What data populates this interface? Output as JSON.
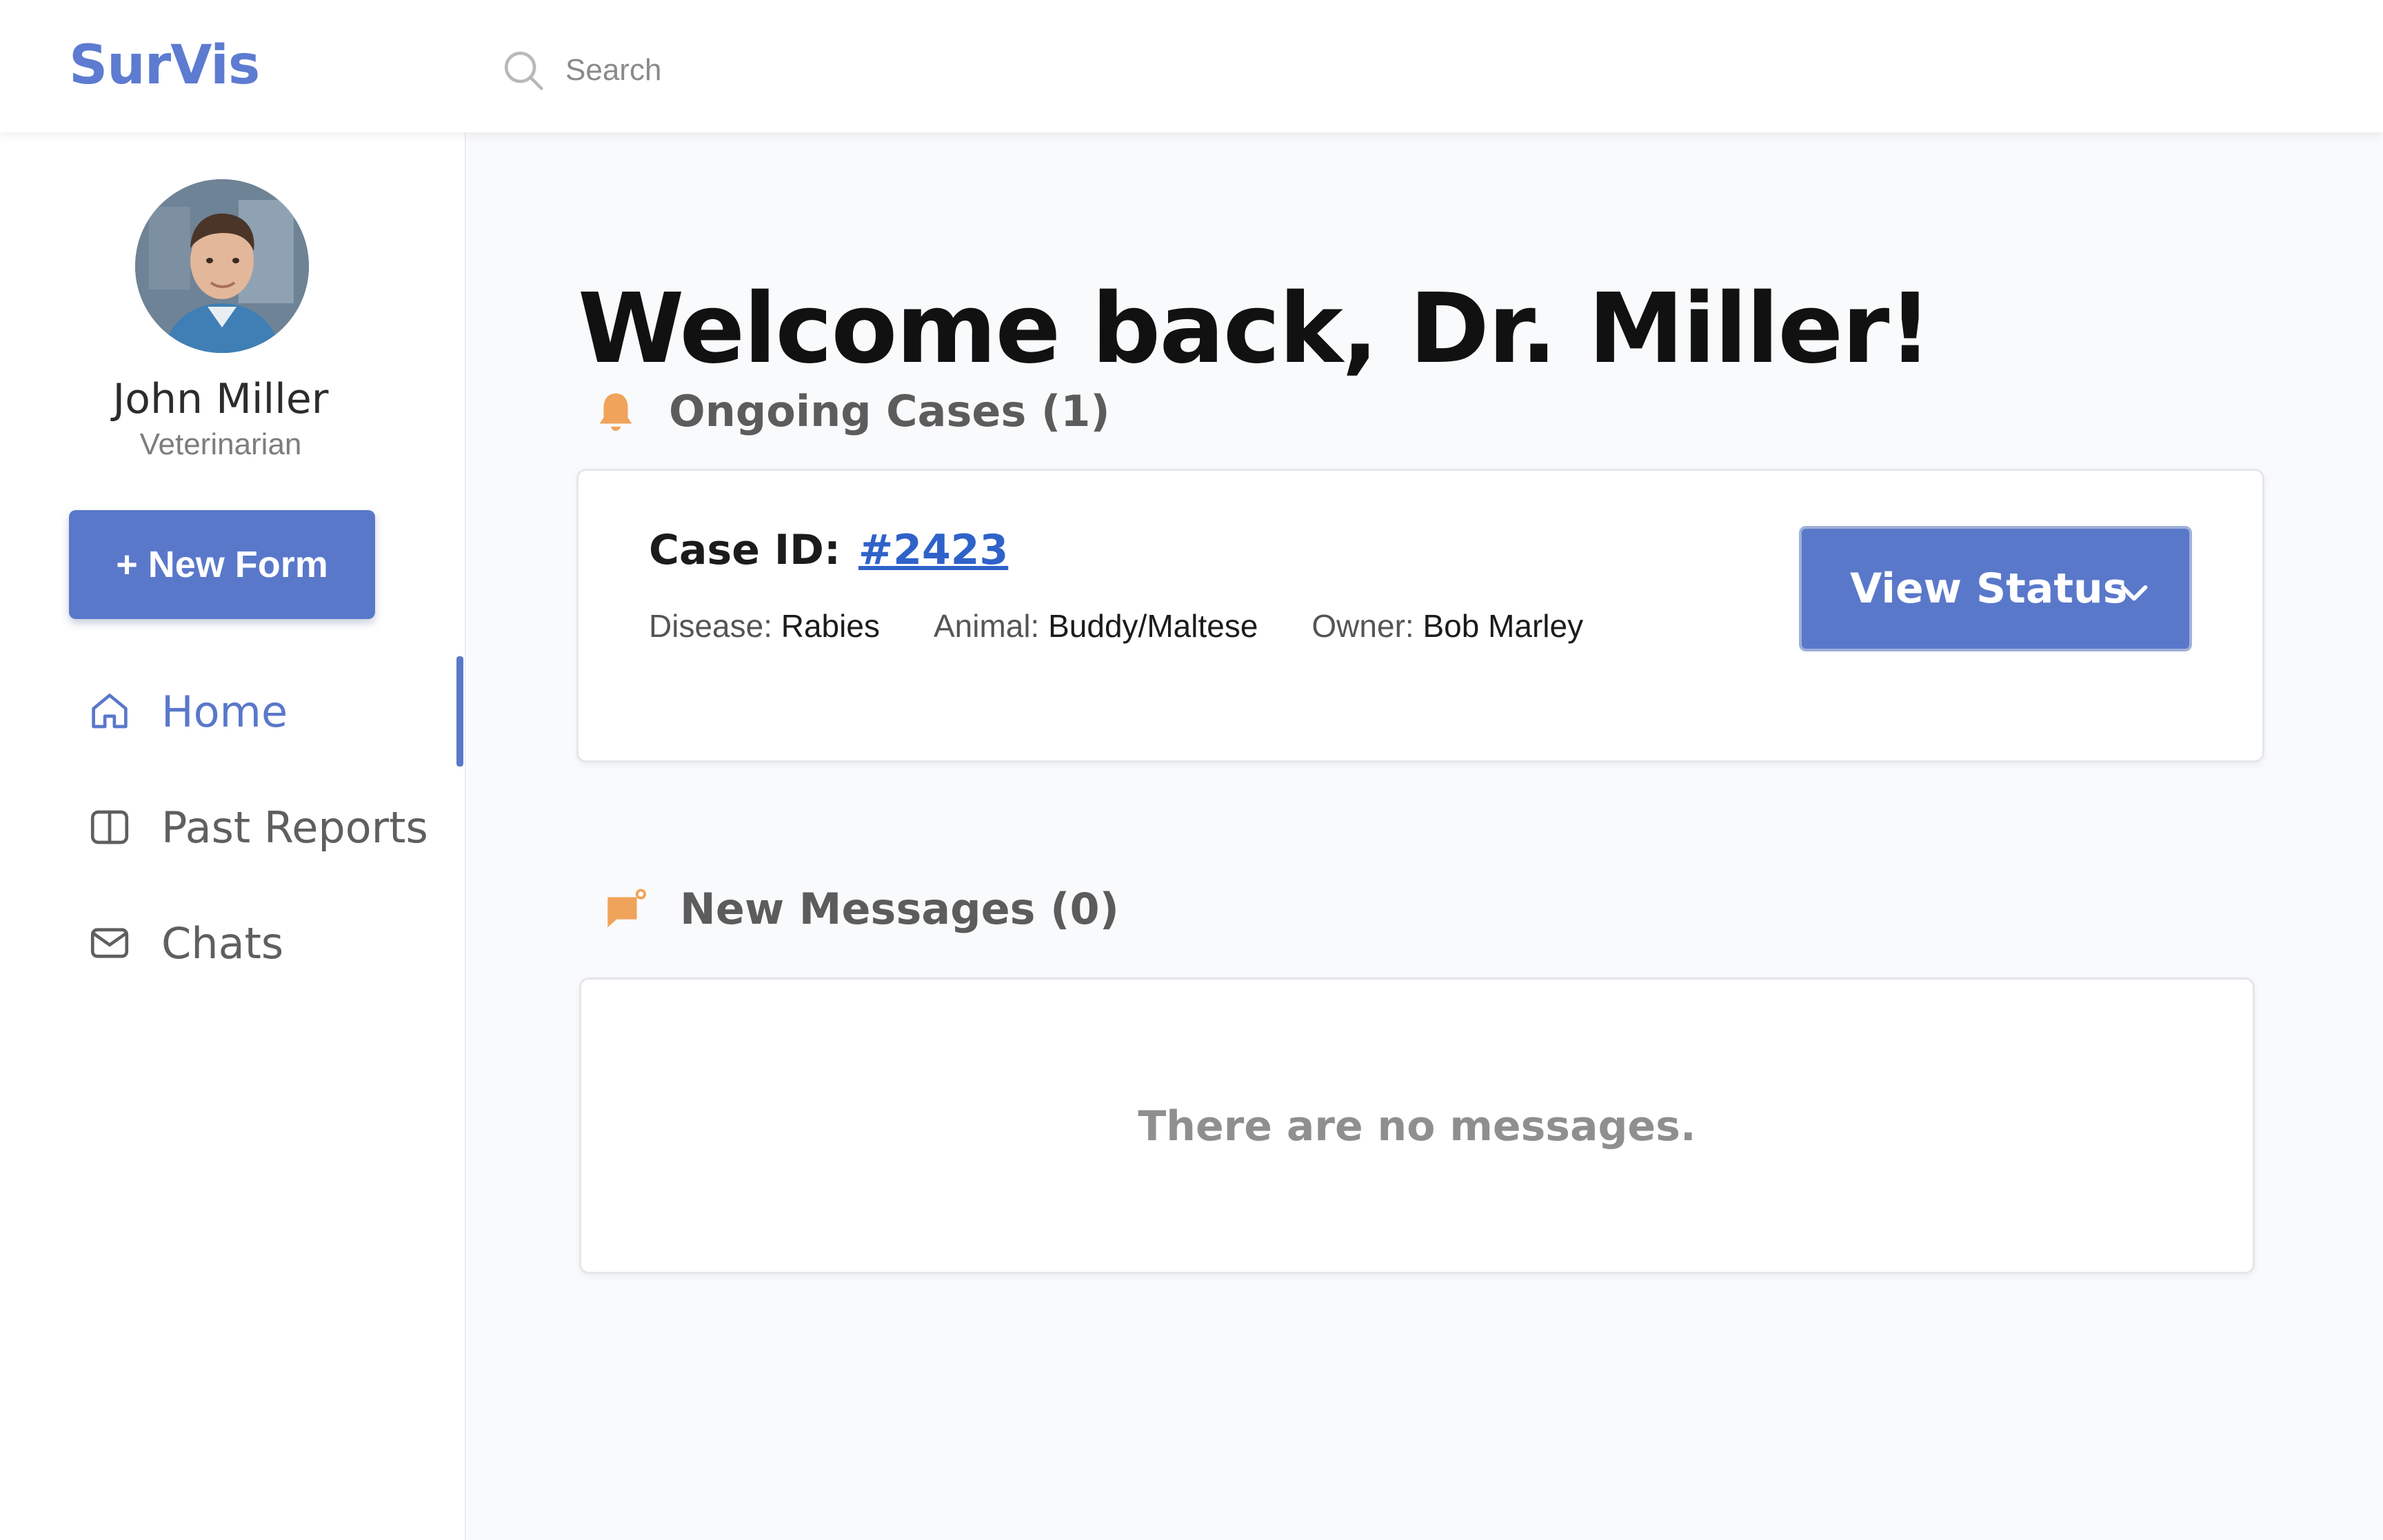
{
  "app": {
    "brand": "SurVis"
  },
  "search": {
    "placeholder": "Search"
  },
  "user": {
    "name": "John Miller",
    "role": "Veterinarian"
  },
  "sidebar": {
    "new_form_label": "+ New Form",
    "items": [
      {
        "label": "Home",
        "icon": "home-icon",
        "active": true
      },
      {
        "label": "Past Reports",
        "icon": "book-icon",
        "active": false
      },
      {
        "label": "Chats",
        "icon": "mail-icon",
        "active": false
      }
    ]
  },
  "main": {
    "welcome": "Welcome back, Dr. Miller!",
    "ongoing": {
      "title": "Ongoing Cases (1)",
      "icon": "bell-icon",
      "case": {
        "id_label": "Case ID:",
        "id_value": "#2423",
        "disease_key": "Disease:",
        "disease_val": "Rabies",
        "animal_key": "Animal:",
        "animal_val": "Buddy/Maltese",
        "owner_key": "Owner:",
        "owner_val": "Bob Marley",
        "status_button": "View Status"
      }
    },
    "messages": {
      "title": "New Messages (0)",
      "icon": "message-notification-icon",
      "empty_text": "There are no messages."
    }
  },
  "colors": {
    "accent": "#5a78ca",
    "link": "#2f62c9",
    "warning_icon": "#f0a35a"
  }
}
